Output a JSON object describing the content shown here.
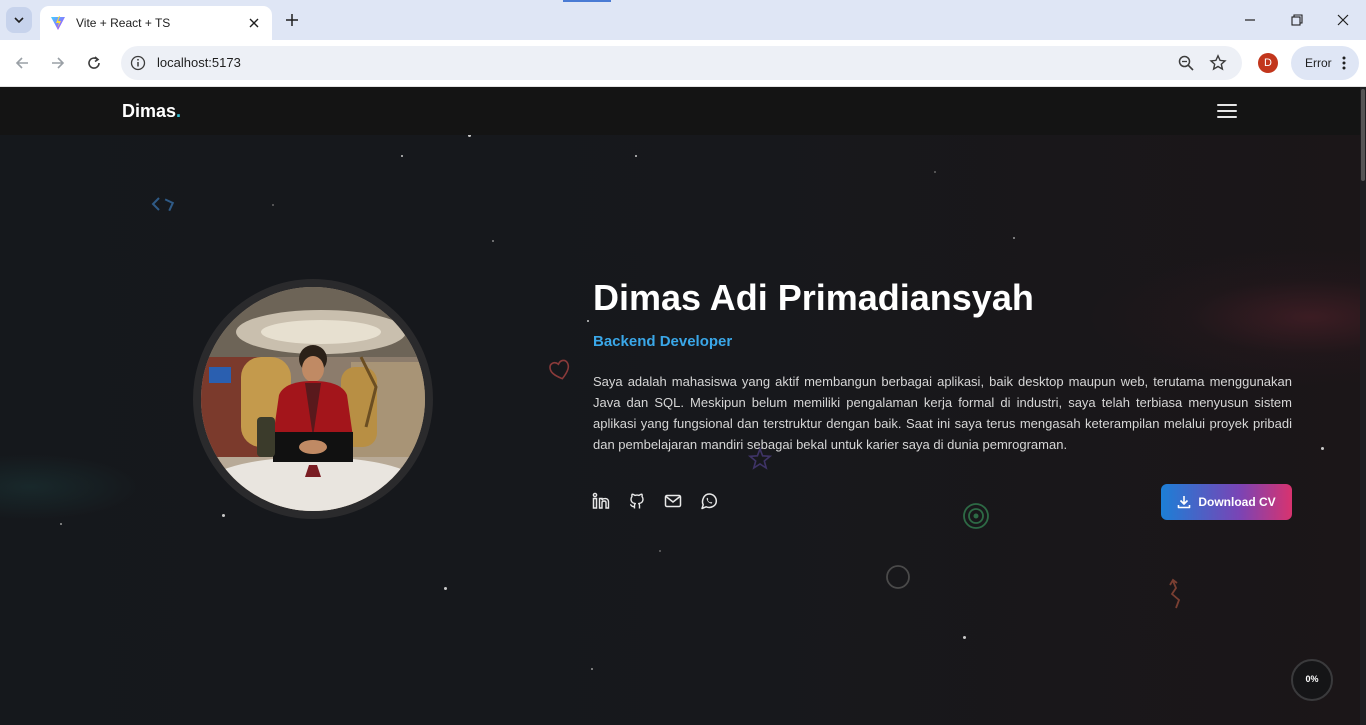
{
  "browser": {
    "tab_title": "Vite + React + TS",
    "url": "localhost:5173",
    "profile_initial": "D",
    "error_label": "Error"
  },
  "navbar": {
    "brand": "Dimas",
    "brand_dot": "."
  },
  "hero": {
    "name": "Dimas Adi Primadiansyah",
    "role": "Backend Developer",
    "description": "Saya adalah mahasiswa yang aktif membangun berbagai aplikasi, baik desktop maupun web, terutama menggunakan Java dan SQL. Meskipun belum memiliki pengalaman kerja formal di industri, saya telah terbiasa menyusun sistem aplikasi yang fungsional dan terstruktur dengan baik. Saat ini saya terus mengasah keterampilan melalui proyek pribadi dan pembelajaran mandiri sebagai bekal untuk karier saya di dunia pemrograman.",
    "download_cv_label": "Download CV"
  },
  "socials": [
    "linkedin-icon",
    "github-icon",
    "mail-icon",
    "whatsapp-icon"
  ],
  "scroll_progress": "0%",
  "colors": {
    "accent_role": "#3aa7e8",
    "brand_dot": "#2fc3d8",
    "cv_gradient_start": "#1c7fd6",
    "cv_gradient_end": "#d8336f",
    "background": "#141518"
  }
}
